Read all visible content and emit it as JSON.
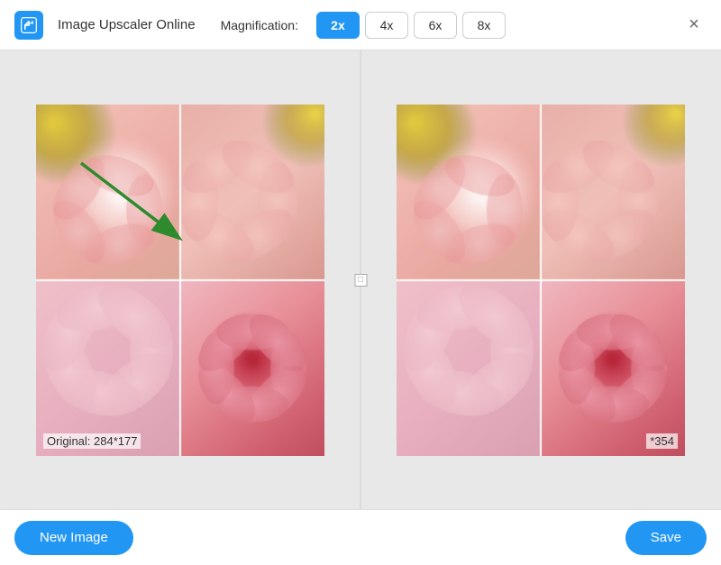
{
  "header": {
    "app_icon_alt": "image-upscaler-icon",
    "app_title": "Image Upscaler Online",
    "magnification_label": "Magnification:",
    "mag_buttons": [
      {
        "label": "2x",
        "active": true
      },
      {
        "label": "4x",
        "active": false
      },
      {
        "label": "6x",
        "active": false
      },
      {
        "label": "8x",
        "active": false
      }
    ],
    "close_label": "×"
  },
  "main": {
    "original_label": "Original: 284*177",
    "upscaled_label": "*354",
    "divider_handle_label": "□"
  },
  "footer": {
    "new_image_label": "New Image",
    "save_label": "Save"
  }
}
